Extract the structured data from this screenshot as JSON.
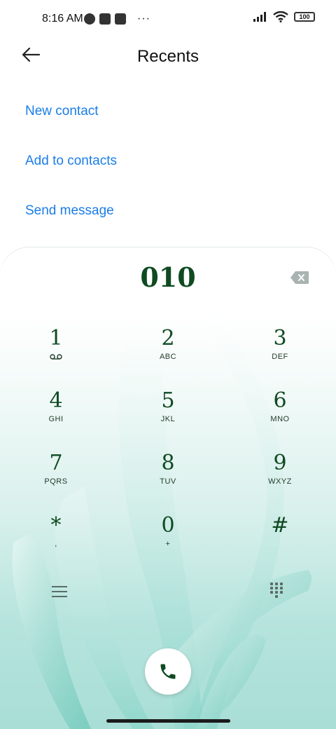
{
  "status_bar": {
    "time": "8:16 AM",
    "battery": "100",
    "more": "···"
  },
  "header": {
    "title": "Recents"
  },
  "actions": {
    "new_contact": "New contact",
    "add_to_contacts": "Add to contacts",
    "send_message": "Send message"
  },
  "dialer": {
    "number": "010",
    "keys": [
      {
        "digit": "1",
        "letters": ""
      },
      {
        "digit": "2",
        "letters": "ABC"
      },
      {
        "digit": "3",
        "letters": "DEF"
      },
      {
        "digit": "4",
        "letters": "GHI"
      },
      {
        "digit": "5",
        "letters": "JKL"
      },
      {
        "digit": "6",
        "letters": "MNO"
      },
      {
        "digit": "7",
        "letters": "PQRS"
      },
      {
        "digit": "8",
        "letters": "TUV"
      },
      {
        "digit": "9",
        "letters": "WXYZ"
      },
      {
        "digit": "*",
        "letters": ","
      },
      {
        "digit": "0",
        "letters": "+"
      },
      {
        "digit": "#",
        "letters": ""
      }
    ]
  },
  "colors": {
    "accent": "#1a7de8",
    "digit": "#0f4a22"
  },
  "icons": [
    "back-arrow-icon",
    "backspace-icon",
    "voicemail-icon",
    "menu-icon",
    "keypad-grid-icon",
    "phone-icon"
  ]
}
